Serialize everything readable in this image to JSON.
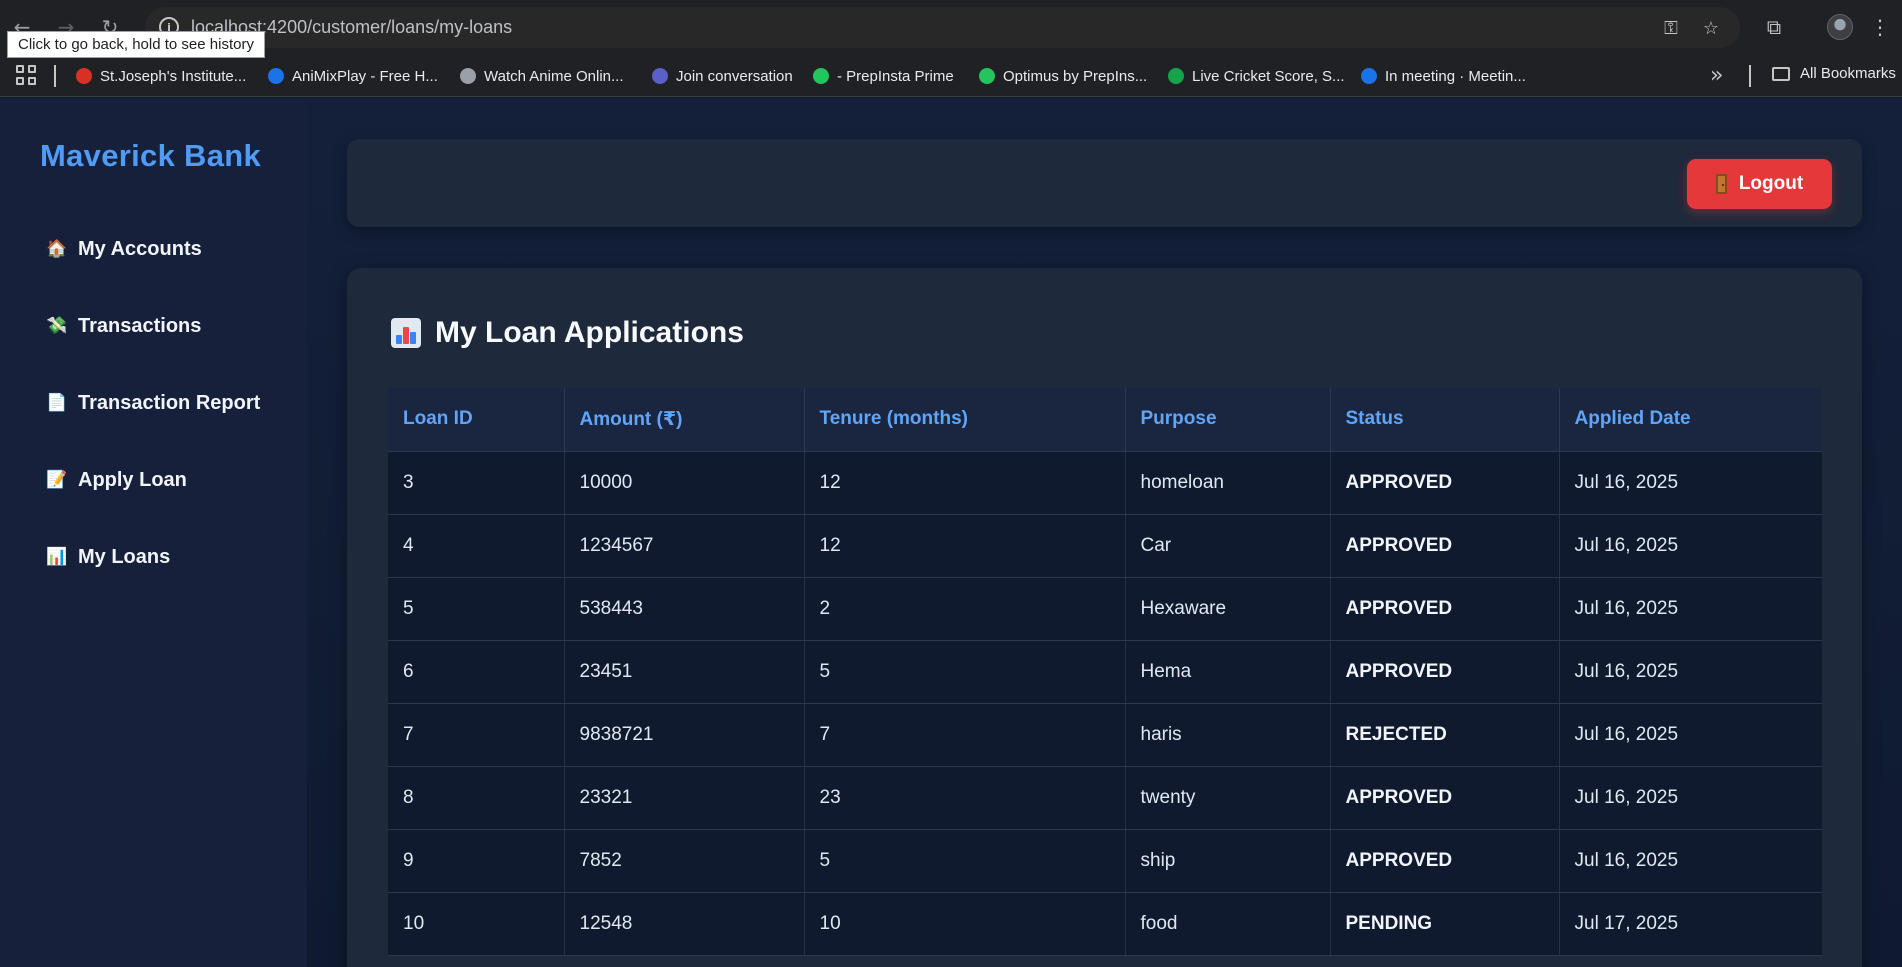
{
  "browser": {
    "url": "localhost:4200/customer/loans/my-loans",
    "tooltip": "Click to go back, hold to see history",
    "bookmarks": [
      {
        "label": "St.Joseph's Institute...",
        "color": "#d93025",
        "icon": "bookmark-favicon"
      },
      {
        "label": "AniMixPlay - Free H...",
        "color": "#1a73e8",
        "icon": "bookmark-favicon"
      },
      {
        "label": "Watch Anime Onlin...",
        "color": "#9aa0a6",
        "icon": "bookmark-favicon"
      },
      {
        "label": "Join conversation",
        "color": "#5b5fc7",
        "icon": "bookmark-favicon"
      },
      {
        "label": "- PrepInsta Prime",
        "color": "#22c55e",
        "icon": "bookmark-favicon"
      },
      {
        "label": "Optimus by PrepIns...",
        "color": "#22c55e",
        "icon": "bookmark-favicon"
      },
      {
        "label": "Live Cricket Score, S...",
        "color": "#16a34a",
        "icon": "bookmark-favicon"
      },
      {
        "label": "In meeting · Meetin...",
        "color": "#1a73e8",
        "icon": "bookmark-favicon"
      }
    ],
    "all_bookmarks": "All Bookmarks"
  },
  "sidebar": {
    "brand": "Maverick Bank",
    "items": [
      {
        "label": "My Accounts",
        "icon": "house-icon",
        "glyph": "🏠"
      },
      {
        "label": "Transactions",
        "icon": "money-icon",
        "glyph": "💸"
      },
      {
        "label": "Transaction Report",
        "icon": "page-icon",
        "glyph": "📄"
      },
      {
        "label": "Apply Loan",
        "icon": "memo-icon",
        "glyph": "📝"
      },
      {
        "label": "My Loans",
        "icon": "chart-icon",
        "glyph": "📊"
      }
    ]
  },
  "topbar": {
    "logout_label": "Logout"
  },
  "loans": {
    "title": "My Loan Applications",
    "columns": [
      "Loan ID",
      "Amount (₹)",
      "Tenure (months)",
      "Purpose",
      "Status",
      "Applied Date"
    ],
    "rows": [
      [
        "3",
        "10000",
        "12",
        "homeloan",
        "APPROVED",
        "Jul 16, 2025"
      ],
      [
        "4",
        "1234567",
        "12",
        "Car",
        "APPROVED",
        "Jul 16, 2025"
      ],
      [
        "5",
        "538443",
        "2",
        "Hexaware",
        "APPROVED",
        "Jul 16, 2025"
      ],
      [
        "6",
        "23451",
        "5",
        "Hema",
        "APPROVED",
        "Jul 16, 2025"
      ],
      [
        "7",
        "9838721",
        "7",
        "haris",
        "REJECTED",
        "Jul 16, 2025"
      ],
      [
        "8",
        "23321",
        "23",
        "twenty",
        "APPROVED",
        "Jul 16, 2025"
      ],
      [
        "9",
        "7852",
        "5",
        "ship",
        "APPROVED",
        "Jul 16, 2025"
      ],
      [
        "10",
        "12548",
        "10",
        "food",
        "PENDING",
        "Jul 17, 2025"
      ]
    ]
  }
}
